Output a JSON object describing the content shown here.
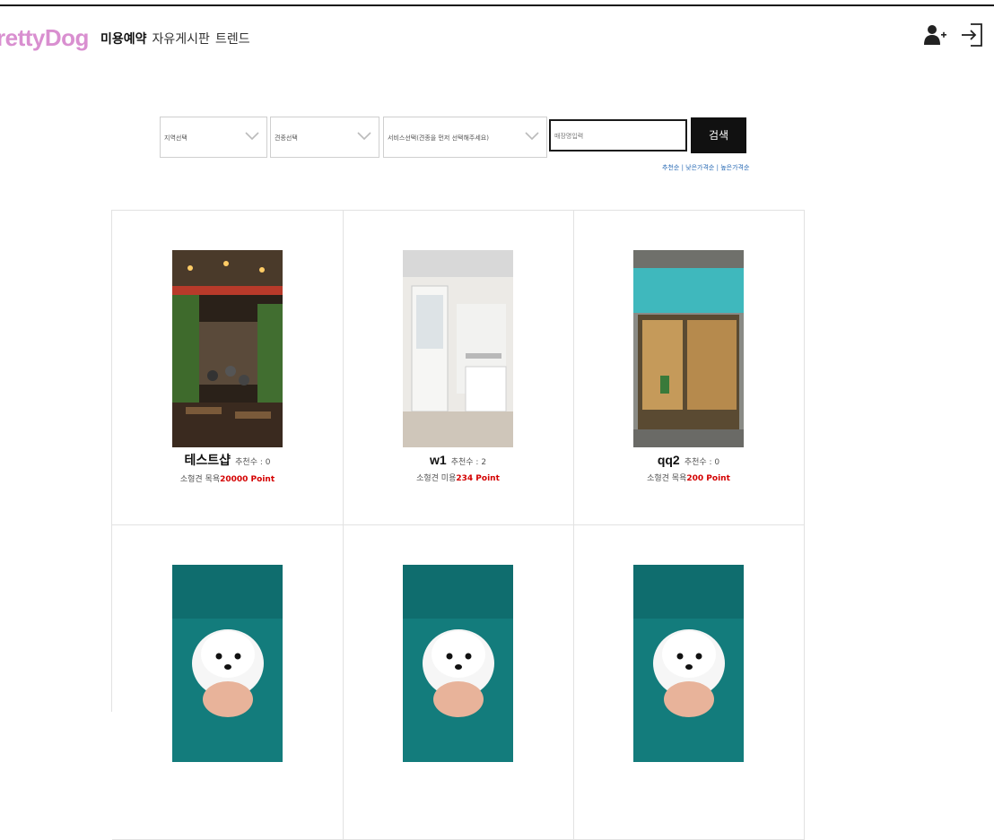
{
  "header": {
    "logo": "rettyDog",
    "nav": [
      "미용예약",
      "자유게시판",
      "트렌드"
    ],
    "icons": [
      "add-user-icon",
      "login-icon"
    ]
  },
  "search": {
    "region_label": "지역선택",
    "dog_label": "견종선택",
    "service_label": "서비스선택(견종을 먼저 선택해주세요)",
    "keyword_placeholder": "매장명입력",
    "button_label": "검색"
  },
  "sort": {
    "options": [
      "추천순",
      "낮은가격순",
      "높은가격순"
    ],
    "separator": "|"
  },
  "shops": [
    {
      "name": "테스트샵",
      "rec_label": "추천수 : ",
      "rec": "0",
      "service": "소형견 목욕",
      "price": "20000 Point",
      "photo": "restaurant-photo"
    },
    {
      "name": "w1",
      "rec_label": "추천수 : ",
      "rec": "2",
      "service": "소형견 미용",
      "price": "234 Point",
      "photo": "white-interior-photo"
    },
    {
      "name": "qq2",
      "rec_label": "추천수 : ",
      "rec": "0",
      "service": "소형견 목욕",
      "price": "200 Point",
      "photo": "storefront-photo"
    },
    {
      "photo": "white-puppy-photo"
    },
    {
      "photo": "white-puppy-photo"
    },
    {
      "photo": "white-puppy-photo"
    }
  ],
  "colors": {
    "brand": "#d98fd0",
    "price": "#d40000",
    "sort_link": "#2a6bb5",
    "button": "#111111"
  }
}
